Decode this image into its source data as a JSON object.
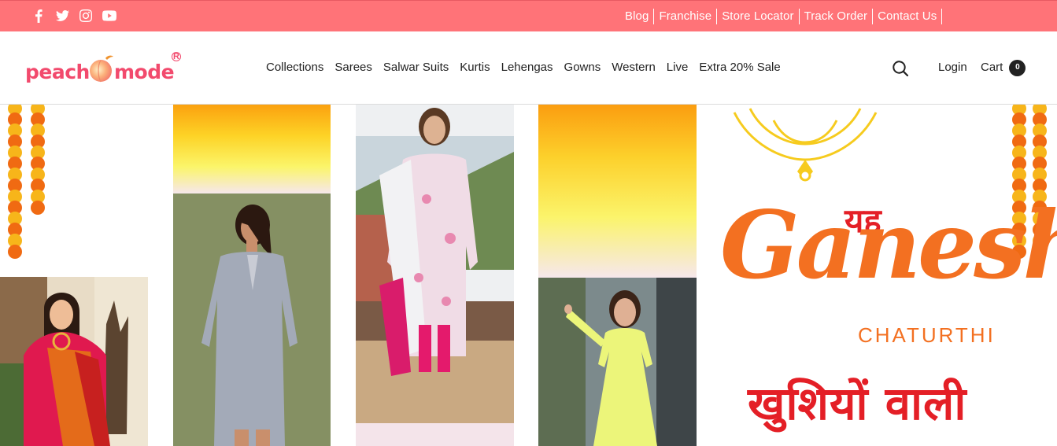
{
  "topbar": {
    "social": [
      {
        "icon": "facebook-icon"
      },
      {
        "icon": "twitter-icon"
      },
      {
        "icon": "instagram-icon"
      },
      {
        "icon": "youtube-icon"
      }
    ],
    "links": [
      "Blog",
      "Franchise",
      "Store Locator",
      "Track Order",
      "Contact Us"
    ],
    "background": "#ff7378"
  },
  "header": {
    "logo": {
      "left_text": "peach",
      "right_text": "mode",
      "reg_mark": "R"
    },
    "nav": [
      "Collections",
      "Sarees",
      "Salwar Suits",
      "Kurtis",
      "Lehengas",
      "Gowns",
      "Western",
      "Live",
      "Extra 20% Sale"
    ],
    "search_icon": "search-icon",
    "login_label": "Login",
    "cart_label": "Cart",
    "cart_count": "0"
  },
  "hero": {
    "hindi_top": "यह",
    "title": "Ganesh",
    "subtitle": "CHATURTHI",
    "hindi_bottom": "खुशियों वाली",
    "accent_orange": "#f37021",
    "accent_red": "#e41f26"
  }
}
